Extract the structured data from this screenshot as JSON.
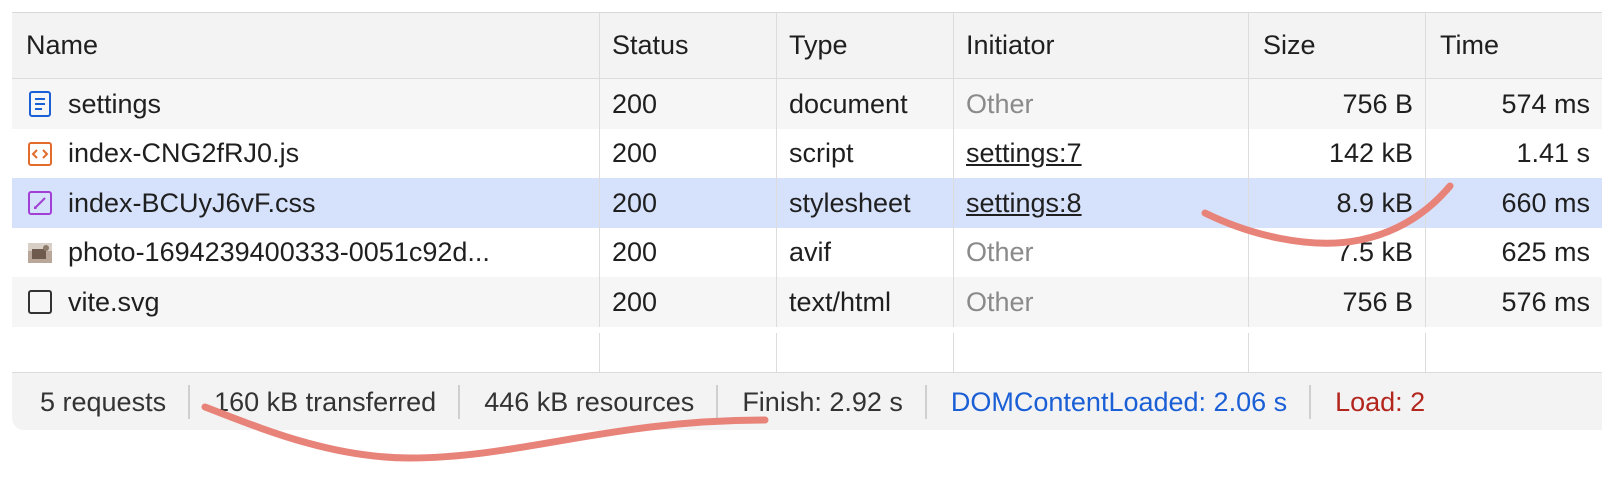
{
  "columns": {
    "name": "Name",
    "status": "Status",
    "type": "Type",
    "initiator": "Initiator",
    "size": "Size",
    "time": "Time"
  },
  "rows": [
    {
      "icon": "document-icon",
      "name": "settings",
      "status": "200",
      "type": "document",
      "initiator": "Other",
      "initiator_is_link": false,
      "size": "756 B",
      "time": "574 ms",
      "selected": false
    },
    {
      "icon": "script-icon",
      "name": "index-CNG2fRJ0.js",
      "status": "200",
      "type": "script",
      "initiator": "settings:7",
      "initiator_is_link": true,
      "size": "142 kB",
      "time": "1.41 s",
      "selected": false
    },
    {
      "icon": "stylesheet-icon",
      "name": "index-BCUyJ6vF.css",
      "status": "200",
      "type": "stylesheet",
      "initiator": "settings:8",
      "initiator_is_link": true,
      "size": "8.9 kB",
      "time": "660 ms",
      "selected": true
    },
    {
      "icon": "image-thumbnail-icon",
      "name": "photo-1694239400333-0051c92d...",
      "status": "200",
      "type": "avif",
      "initiator": "Other",
      "initiator_is_link": false,
      "size": "7.5 kB",
      "time": "625 ms",
      "selected": false
    },
    {
      "icon": "file-icon",
      "name": "vite.svg",
      "status": "200",
      "type": "text/html",
      "initiator": "Other",
      "initiator_is_link": false,
      "size": "756 B",
      "time": "576 ms",
      "selected": false
    }
  ],
  "summary": {
    "requests": "5 requests",
    "transferred": "160 kB transferred",
    "resources": "446 kB resources",
    "finish": "Finish: 2.92 s",
    "dom_content_loaded": "DOMContentLoaded: 2.06 s",
    "load": "Load: 2"
  },
  "colors": {
    "selected_row": "#d6e2fb",
    "alt_row": "#f6f6f6",
    "link_blue": "#1a5fd6",
    "load_red": "#b3261e",
    "annotation": "#e8837a"
  }
}
